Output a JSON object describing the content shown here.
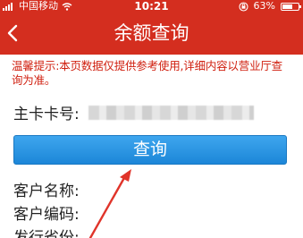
{
  "status_bar": {
    "carrier": "中国移动",
    "time": "10:21",
    "battery": "63%",
    "battery_level": 0.63
  },
  "nav": {
    "title": "余额查询"
  },
  "notice": "温馨提示:本页数据仅提供参考使用,详细内容以营业厅查询为准。",
  "card": {
    "label": "主卡卡号:",
    "value_masked": true
  },
  "query_button": "查询",
  "info_fields": [
    {
      "label": "客户名称:"
    },
    {
      "label": "客户编码:"
    },
    {
      "label": "发行省份:"
    }
  ],
  "colors": {
    "header": "#d42e1f",
    "notice": "#d02010",
    "button": "#1c86d8",
    "annotation_arrow": "#e0342a"
  }
}
